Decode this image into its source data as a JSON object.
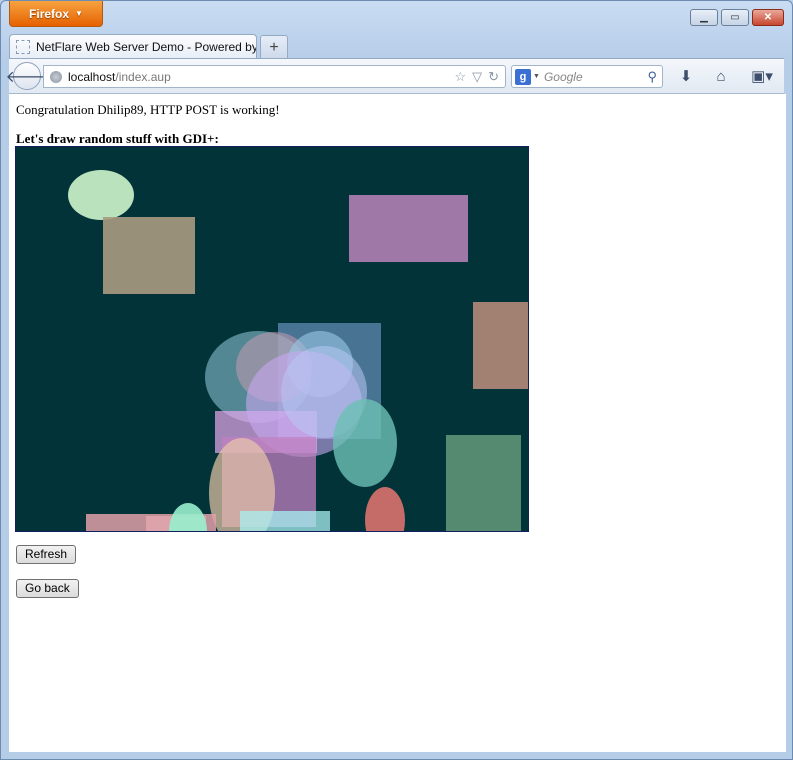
{
  "browser": {
    "menu_button": "Firefox",
    "tab_title": "NetFlare Web Server Demo - Powered by...",
    "new_tab": "+",
    "url_host": "localhost",
    "url_path": "/index.aup",
    "search_engine_letter": "g",
    "search_placeholder": "Google"
  },
  "page": {
    "greeting": "Congratulation Dhilip89, HTTP POST is working!",
    "heading": "Let's draw random stuff with GDI+:",
    "refresh_label": "Refresh",
    "back_label": "Go back"
  },
  "colors": {
    "canvas_background": "#013338",
    "firefox_orange": "#e66000"
  },
  "icons": [
    "back-arrow-icon",
    "globe-icon",
    "bookmark-star-icon",
    "history-dropdown-icon",
    "reload-icon",
    "search-magnifier-icon",
    "download-icon",
    "home-icon",
    "bookmarks-menu-icon"
  ]
}
